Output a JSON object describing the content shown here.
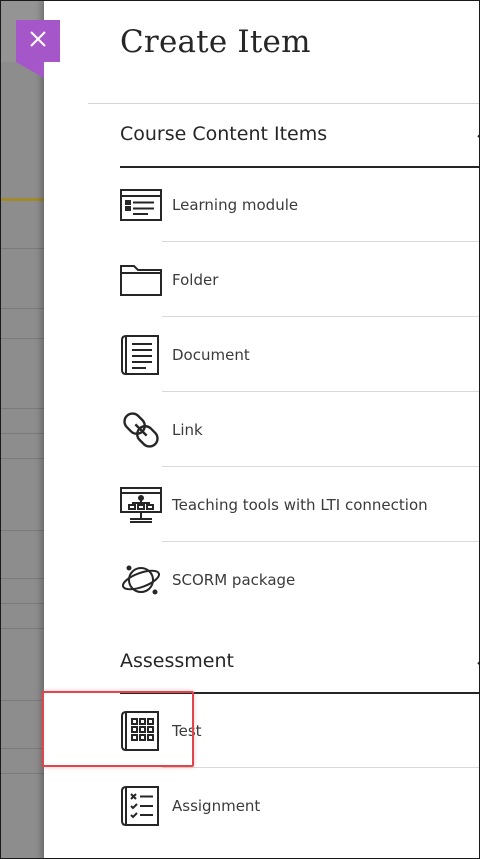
{
  "panel": {
    "title": "Create Item",
    "close_icon": "close-icon",
    "accent_color": "#a557c9"
  },
  "sections": [
    {
      "title": "Course Content Items",
      "toggle_icon": "chevron-up-icon",
      "items": [
        {
          "label": "Learning module",
          "icon": "learning-module-icon"
        },
        {
          "label": "Folder",
          "icon": "folder-icon"
        },
        {
          "label": "Document",
          "icon": "document-icon"
        },
        {
          "label": "Link",
          "icon": "link-icon"
        },
        {
          "label": "Teaching tools with LTI connection",
          "icon": "lti-tool-icon"
        },
        {
          "label": "SCORM package",
          "icon": "scorm-package-icon"
        }
      ]
    },
    {
      "title": "Assessment",
      "toggle_icon": "chevron-up-icon",
      "items": [
        {
          "label": "Test",
          "icon": "test-icon"
        },
        {
          "label": "Assignment",
          "icon": "assignment-icon"
        }
      ]
    }
  ],
  "highlight_color": "#e0474c"
}
